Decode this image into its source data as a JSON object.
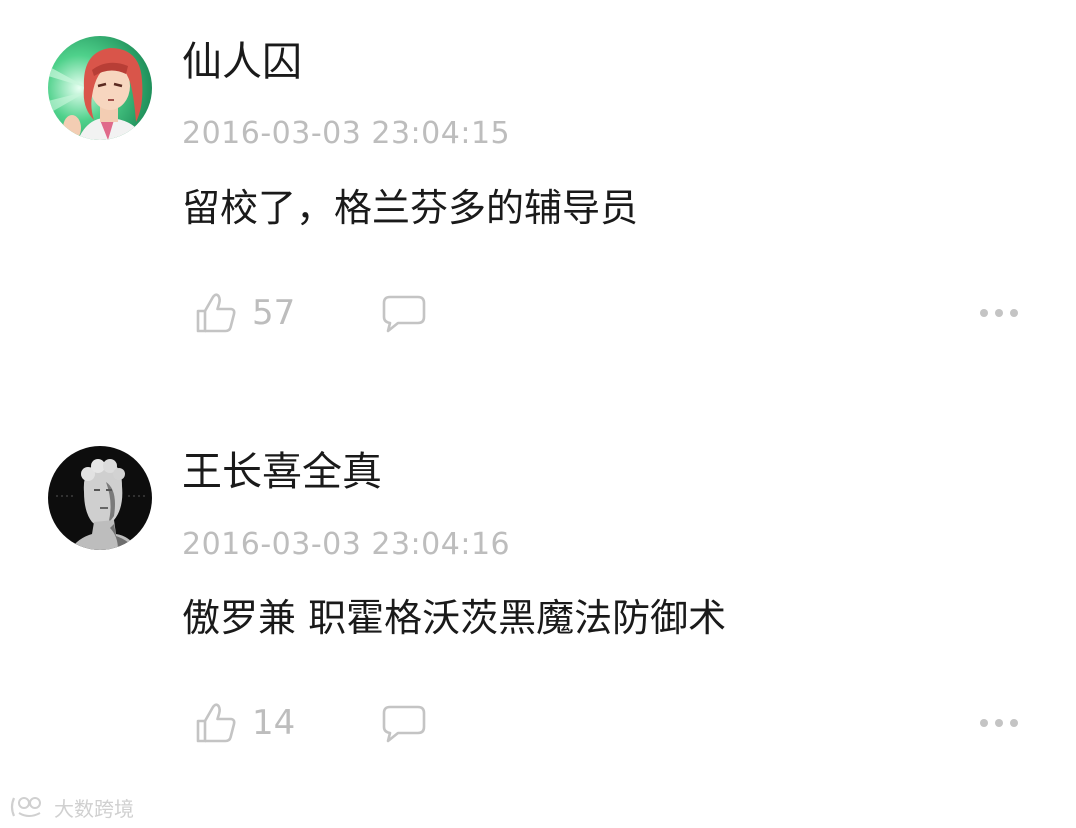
{
  "comments": [
    {
      "avatar": "anime-red-hair-avatar",
      "username": "仙人囚",
      "timestamp": "2016-03-03 23:04:15",
      "content": "留校了，格兰芬多的辅导员",
      "likes": "57"
    },
    {
      "avatar": "statue-bust-avatar",
      "username": "王长喜全真",
      "timestamp": "2016-03-03 23:04:16",
      "content": "傲罗兼 职霍格沃茨黑魔法防御术",
      "likes": "14"
    }
  ],
  "icons": {
    "like": "thumbs-up-icon",
    "reply": "speech-bubble-icon",
    "more": "more-dots-icon"
  },
  "watermark": {
    "text": "大数跨境"
  },
  "colors": {
    "text_primary": "#1a1a1a",
    "text_secondary": "#bdbdbd",
    "icon": "#c4c4c4"
  }
}
